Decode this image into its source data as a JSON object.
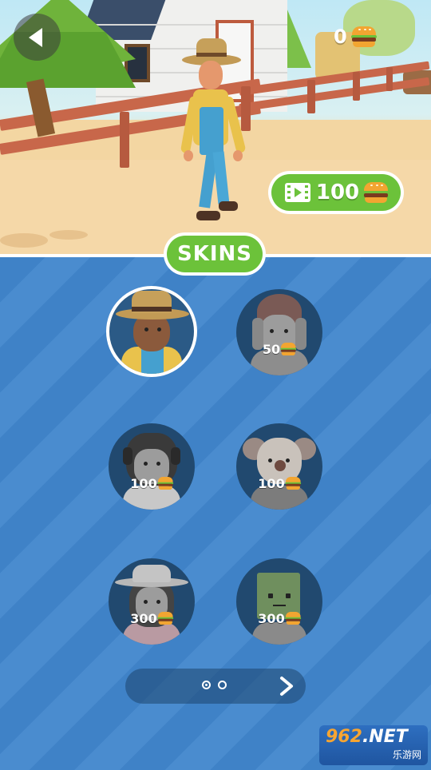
{
  "header": {
    "back_label": "back",
    "coins": "0",
    "video_reward": "100"
  },
  "panel": {
    "title": "SKINS"
  },
  "skins": [
    {
      "name": "farmer",
      "price": "",
      "selected": true
    },
    {
      "name": "hooded",
      "price": "50"
    },
    {
      "name": "headphones-girl",
      "price": "100"
    },
    {
      "name": "koala",
      "price": "100"
    },
    {
      "name": "hat-woman",
      "price": "300"
    },
    {
      "name": "cube-head",
      "price": "300"
    }
  ],
  "pagination": {
    "pages": 2,
    "current": 1
  },
  "watermark": {
    "brand_digits": "962",
    "brand_suffix": ".NET",
    "brand_sub": "乐游网"
  },
  "colors": {
    "accent_green": "#6cc23a",
    "panel_blue": "#3f82c7",
    "skin_circle": "#21496f"
  }
}
